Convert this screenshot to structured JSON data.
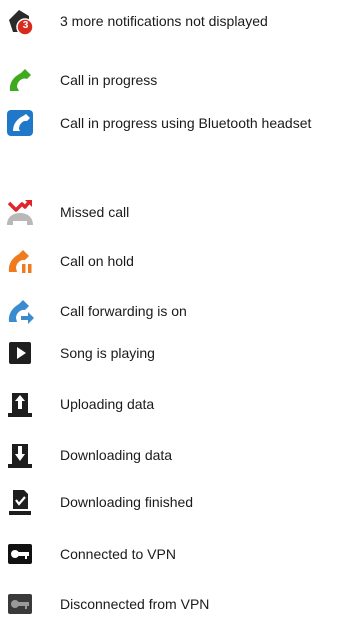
{
  "legend": {
    "items": [
      {
        "icon": "notifications-more-icon",
        "badge": "3",
        "label": "3 more notifications not displayed"
      },
      {
        "icon": "call-in-progress-icon",
        "label": "Call in progress"
      },
      {
        "icon": "bluetooth-call-icon",
        "label": "Call in progress using Bluetooth headset"
      },
      {
        "icon": "missed-call-icon",
        "label": "Missed call"
      },
      {
        "icon": "call-on-hold-icon",
        "label": "Call on hold"
      },
      {
        "icon": "call-forwarding-icon",
        "label": "Call forwarding is on"
      },
      {
        "icon": "play-icon",
        "label": "Song is playing"
      },
      {
        "icon": "upload-icon",
        "label": "Uploading data"
      },
      {
        "icon": "download-icon",
        "label": "Downloading data"
      },
      {
        "icon": "download-finished-icon",
        "label": "Downloading finished"
      },
      {
        "icon": "vpn-connected-icon",
        "label": "Connected to VPN"
      },
      {
        "icon": "vpn-disconnected-icon",
        "label": "Disconnected from VPN"
      }
    ]
  },
  "colors": {
    "text": "#1a1a1a",
    "call_green": "#3faa1f",
    "bluetooth_blue": "#1f78c8",
    "missed_red": "#e0262b",
    "hold_orange": "#f07a1e",
    "forward_blue": "#3a8ccf",
    "badge_red": "#d72b1e",
    "icon_dark": "#1e1e1e"
  }
}
